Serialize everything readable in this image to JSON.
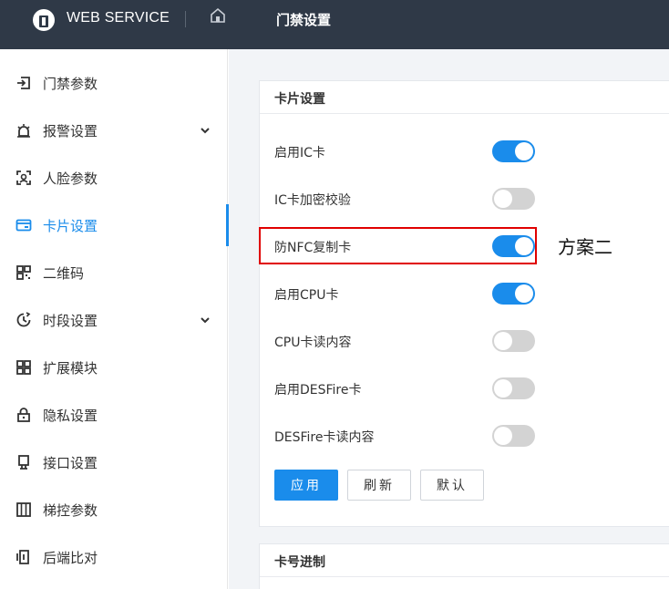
{
  "header": {
    "brand": "WEB SERVICE",
    "breadcrumb": "门禁设置"
  },
  "sidebar": {
    "items": [
      {
        "label": "门禁参数",
        "icon": "door-login-icon"
      },
      {
        "label": "报警设置",
        "icon": "alarm-icon",
        "expandable": true
      },
      {
        "label": "人脸参数",
        "icon": "face-scan-icon"
      },
      {
        "label": "卡片设置",
        "icon": "card-icon",
        "active": true
      },
      {
        "label": "二维码",
        "icon": "qrcode-icon"
      },
      {
        "label": "时段设置",
        "icon": "clock-icon",
        "expandable": true
      },
      {
        "label": "扩展模块",
        "icon": "grid-icon"
      },
      {
        "label": "隐私设置",
        "icon": "lock-icon"
      },
      {
        "label": "接口设置",
        "icon": "interface-icon"
      },
      {
        "label": "梯控参数",
        "icon": "elevator-icon"
      },
      {
        "label": "后端比对",
        "icon": "backend-icon"
      }
    ]
  },
  "card_settings": {
    "title": "卡片设置",
    "rows": [
      {
        "label": "启用IC卡",
        "enabled": true
      },
      {
        "label": "IC卡加密校验",
        "enabled": false
      },
      {
        "label": "防NFC复制卡",
        "enabled": true
      },
      {
        "label": "启用CPU卡",
        "enabled": true
      },
      {
        "label": "CPU卡读内容",
        "enabled": false
      },
      {
        "label": "启用DESFire卡",
        "enabled": false
      },
      {
        "label": "DESFire卡读内容",
        "enabled": false
      }
    ],
    "buttons": {
      "apply": "应用",
      "refresh": "刷新",
      "default": "默认"
    }
  },
  "annotation": {
    "text": "方案二"
  },
  "card_number": {
    "title": "卡号进制"
  },
  "colors": {
    "topbar": "#2f3947",
    "accent": "#1a8ceb",
    "toggle_off": "#d3d3d3",
    "highlight": "#e00000"
  }
}
